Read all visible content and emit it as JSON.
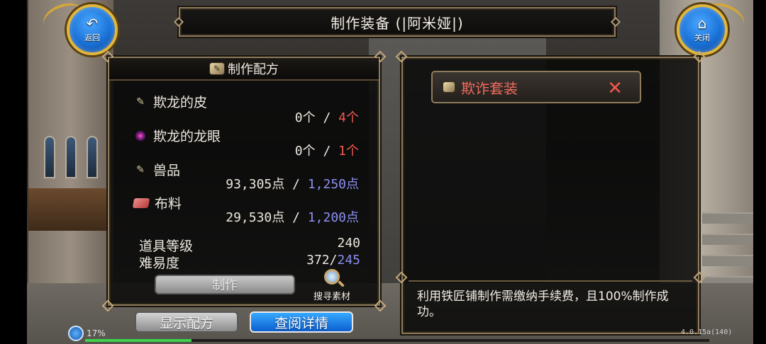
{
  "window": {
    "title": "制作装备 (|阿米娅|)"
  },
  "nav": {
    "back_label": "返回",
    "close_label": "关闭"
  },
  "recipe": {
    "header": "制作配方",
    "materials": [
      {
        "icon": "claw-icon",
        "name": "欺龙的皮",
        "have": "0个",
        "sep": "/",
        "need": "4个",
        "need_color": "red"
      },
      {
        "icon": "eye-orb-icon",
        "name": "欺龙的龙眼",
        "have": "0个",
        "sep": "/",
        "need": "1个",
        "need_color": "red"
      },
      {
        "icon": "claw-icon",
        "name": "兽品",
        "have": "93,305点",
        "sep": "/",
        "need": "1,250点",
        "need_color": "blue"
      },
      {
        "icon": "cloth-icon",
        "name": "布料",
        "have": "29,530点",
        "sep": "/",
        "need": "1,200点",
        "need_color": "blue"
      }
    ],
    "item_level_label": "道具等级",
    "item_level_value": "240",
    "difficulty_label": "难易度",
    "difficulty_have": "372/",
    "difficulty_need": "245",
    "make_button": "制作",
    "search_material": "搜寻素材"
  },
  "set": {
    "name": "欺诈套装",
    "info": "利用铁匠铺制作需缴纳手续费，且100%制作成功。"
  },
  "buttons": {
    "show_recipe": "显示配方",
    "view_detail": "查阅详情"
  },
  "status": {
    "battery": "17%",
    "version": "4.0.15a(140)",
    "xp_fraction": 0.17
  },
  "colors": {
    "required_red": "#f05a4f",
    "required_blue": "#8c8ff0",
    "gold_trim": "#8f7b5c",
    "primary_button": "#0b5fcf"
  }
}
